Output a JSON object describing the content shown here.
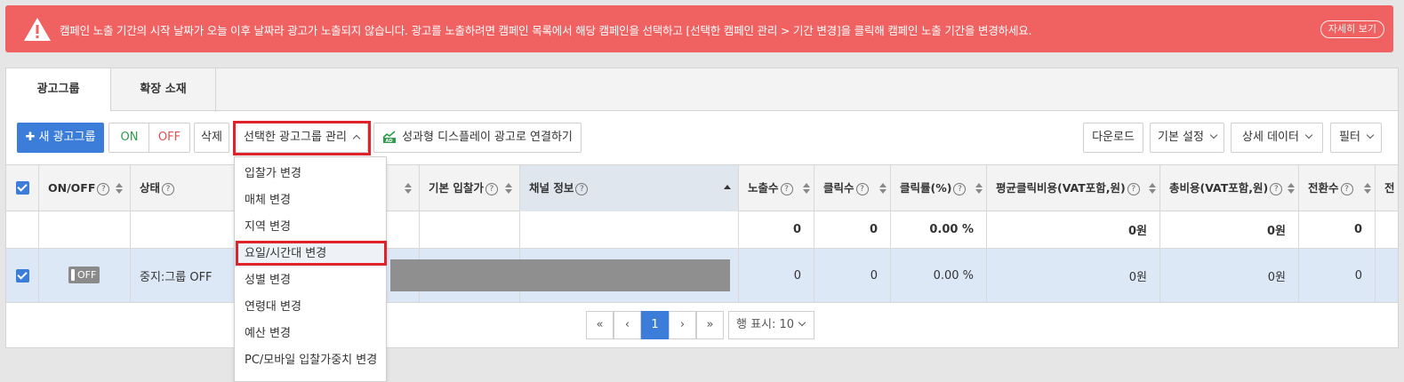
{
  "alert": {
    "message": "캠페인 노출 기간의 시작 날짜가 오늘 이후 날짜라 광고가 노출되지 않습니다. 광고를 노출하려면 캠페인 목록에서 해당 캠페인을 선택하고 [선택한 캠페인 관리 > 기간 변경]을 클릭해 캠페인 노출 기간을 변경하세요.",
    "details_button": "자세히 보기",
    "icon": "warning-icon",
    "color": "#f06262"
  },
  "tabs": [
    {
      "label": "광고그룹",
      "active": true
    },
    {
      "label": "확장 소재",
      "active": false
    }
  ],
  "toolbar": {
    "new_group": "새 광고그룹",
    "on": "ON",
    "off": "OFF",
    "delete": "삭제",
    "manage_selected": "선택한 광고그룹 관리",
    "link_display": "성과형 디스플레이 광고로 연결하기",
    "download": "다운로드",
    "basic_settings": "기본 설정",
    "detail_data": "상세 데이터",
    "filter": "필터"
  },
  "dropdown": {
    "items": [
      "입찰가 변경",
      "매체 변경",
      "지역 변경",
      "요일/시간대 변경",
      "성별 변경",
      "연령대 변경",
      "예산 변경",
      "PC/모바일 입찰가중치 변경"
    ],
    "highlighted": "요일/시간대 변경"
  },
  "table": {
    "headers": {
      "onoff": "ON/OFF",
      "status": "상태",
      "base_bid": "기본 입찰가",
      "channel": "채널 정보",
      "impressions": "노출수",
      "clicks": "클릭수",
      "ctr": "클릭률(%)",
      "avg_cpc": "평균클릭비용(VAT포함,원)",
      "total_cost": "총비용(VAT포함,원)",
      "conversions": "전환수",
      "next": "전"
    },
    "summary": {
      "impressions": "0",
      "clicks": "0",
      "ctr": "0.00 %",
      "avg_cpc": "0원",
      "total_cost": "0원",
      "conversions": "0"
    },
    "rows": [
      {
        "toggle": "OFF",
        "status": "중지:그룹 OFF",
        "impressions": "0",
        "clicks": "0",
        "ctr": "0.00 %",
        "avg_cpc": "0원",
        "total_cost": "0원",
        "conversions": "0"
      }
    ]
  },
  "pagination": {
    "first": "«",
    "prev": "‹",
    "current": "1",
    "next": "›",
    "last": "»",
    "rows_per_page": "행 표시: 10"
  }
}
